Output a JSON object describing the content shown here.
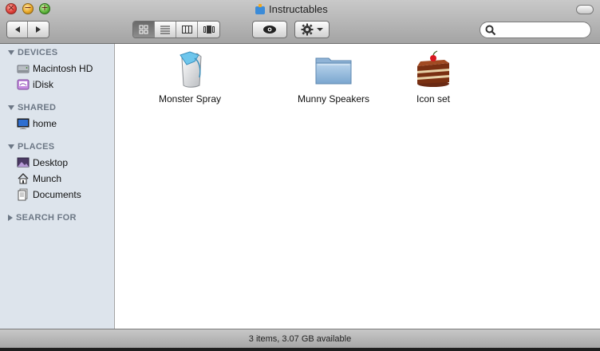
{
  "window": {
    "title": "Instructables",
    "title_icon": "package-icon"
  },
  "toolbar": {
    "back_icon": "back-arrow-icon",
    "forward_icon": "forward-arrow-icon",
    "view_modes": [
      {
        "name": "icon-view",
        "icon": "grid-icon",
        "active": true
      },
      {
        "name": "list-view",
        "icon": "list-icon",
        "active": false
      },
      {
        "name": "column-view",
        "icon": "columns-icon",
        "active": false
      },
      {
        "name": "coverflow-view",
        "icon": "coverflow-icon",
        "active": false
      }
    ],
    "quicklook_icon": "eye-icon",
    "action_icon": "gear-icon",
    "search": {
      "value": "",
      "placeholder": ""
    }
  },
  "sidebar": {
    "devices": {
      "header": "DEVICES",
      "items": [
        {
          "label": "Macintosh HD",
          "icon": "hard-drive-icon"
        },
        {
          "label": "iDisk",
          "icon": "idisk-icon"
        }
      ]
    },
    "shared": {
      "header": "SHARED",
      "items": [
        {
          "label": "home",
          "icon": "computer-icon"
        }
      ]
    },
    "places": {
      "header": "PLACES",
      "items": [
        {
          "label": "Desktop",
          "icon": "desktop-icon"
        },
        {
          "label": "Munch",
          "icon": "home-icon"
        },
        {
          "label": "Documents",
          "icon": "documents-icon"
        }
      ]
    },
    "search_for": {
      "header": "SEARCH FOR"
    }
  },
  "files": [
    {
      "label": "Monster Spray",
      "icon": "monster-spray-icon"
    },
    {
      "label": "Munny Speakers",
      "icon": "folder-icon"
    },
    {
      "label": "Icon set",
      "icon": "cake-icon"
    }
  ],
  "status": {
    "text": "3 items, 3.07 GB available"
  },
  "colors": {
    "sidebar_bg": "#dde4ec",
    "sidebar_header": "#6c7785",
    "folder_blue": "#8fb6d8"
  }
}
